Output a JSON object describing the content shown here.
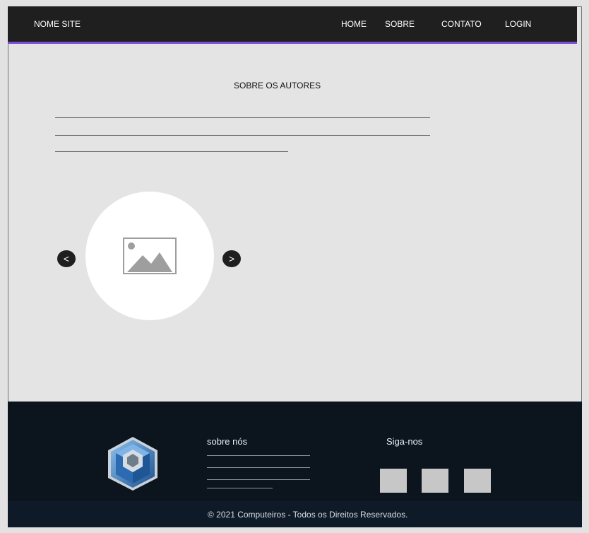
{
  "header": {
    "site_name": "NOME SITE",
    "nav_items": [
      "HOME",
      "SOBRE",
      "CONTATO",
      "LOGIN"
    ]
  },
  "main": {
    "title": "SOBRE OS AUTORES",
    "carousel": {
      "prev_icon": "<",
      "next_icon": ">",
      "image_icon": "image-placeholder-icon"
    }
  },
  "footer": {
    "about_title": "sobre nós",
    "follow_title": "Siga-nos",
    "copyright": "© 2021 Computeiros - Todos os Direitos Reservados."
  },
  "colors": {
    "topbar_bg": "#201f20",
    "topbar_accent": "#7c4dd6",
    "footer_bg": "#0c151d",
    "footer_bottom_bg": "#0e1a28"
  }
}
